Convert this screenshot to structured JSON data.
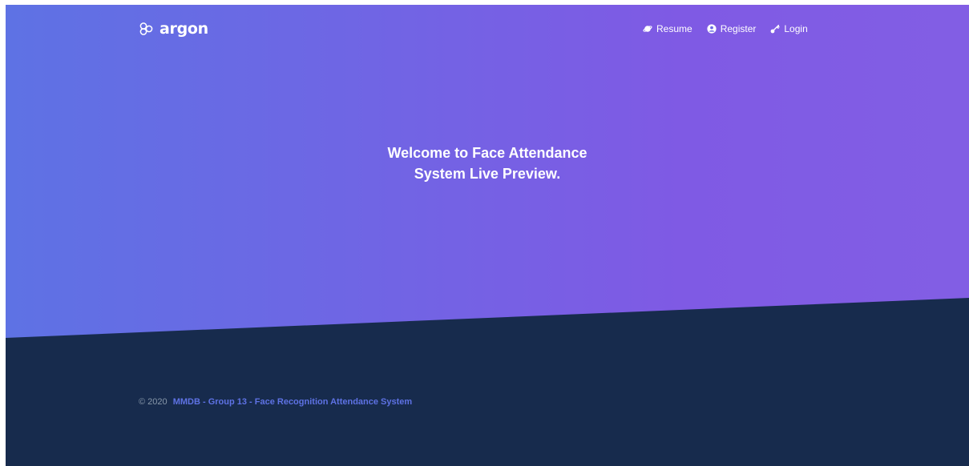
{
  "brand": {
    "name": "argon",
    "icon": "argon-logo-icon"
  },
  "nav": {
    "items": [
      {
        "label": "Resume",
        "icon": "planet-icon"
      },
      {
        "label": "Register",
        "icon": "user-circle-icon"
      },
      {
        "label": "Login",
        "icon": "key-icon"
      }
    ]
  },
  "hero": {
    "title_line_1": "Welcome to Face Attendance",
    "title_line_2": "System Live Preview."
  },
  "footer": {
    "copyright": "© 2020",
    "link_text": "MMDB - Group 13 - Face Recognition Attendance System"
  },
  "colors": {
    "gradient_start": "#5e72e4",
    "gradient_end": "#825ee4",
    "footer_background": "#172b4d",
    "footer_link": "#5e72e4",
    "footer_text": "#8898aa"
  }
}
